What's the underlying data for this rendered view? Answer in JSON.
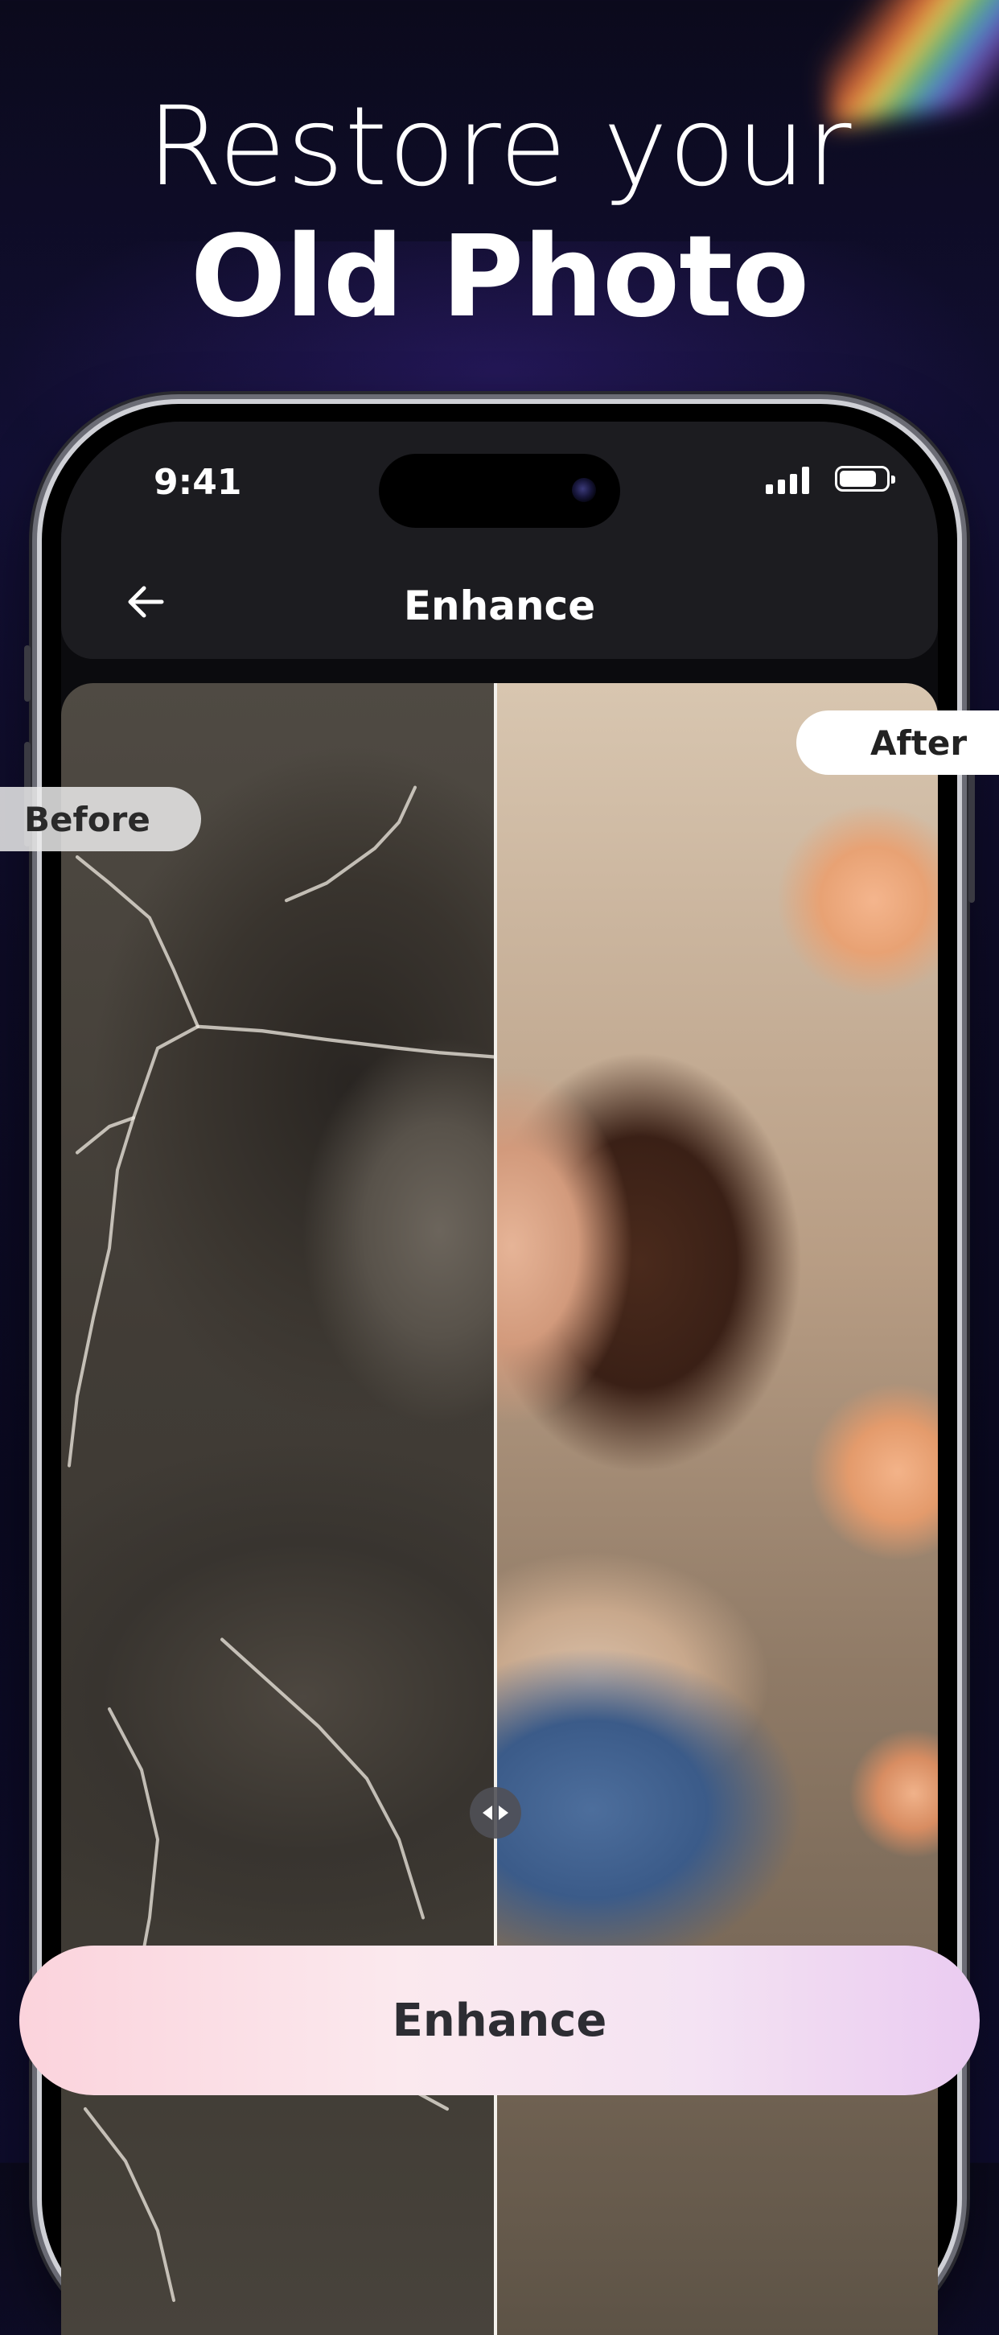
{
  "headline": {
    "line1": "Restore your",
    "line2": "Old Photo"
  },
  "status_bar": {
    "time": "9:41",
    "icons": [
      "signal-icon",
      "battery-icon"
    ]
  },
  "nav": {
    "back_icon": "arrow-left-icon",
    "title": "Enhance"
  },
  "comparison": {
    "before_label": "Before",
    "after_label": "After",
    "handle_icon": "drag-handle-icon"
  },
  "cta": {
    "label": "Enhance"
  },
  "colors": {
    "background": "#0b0a1c",
    "cta_gradient_start": "#fbd3dc",
    "cta_gradient_end": "#eacbf1",
    "nav_bar": "#1c1c20"
  }
}
